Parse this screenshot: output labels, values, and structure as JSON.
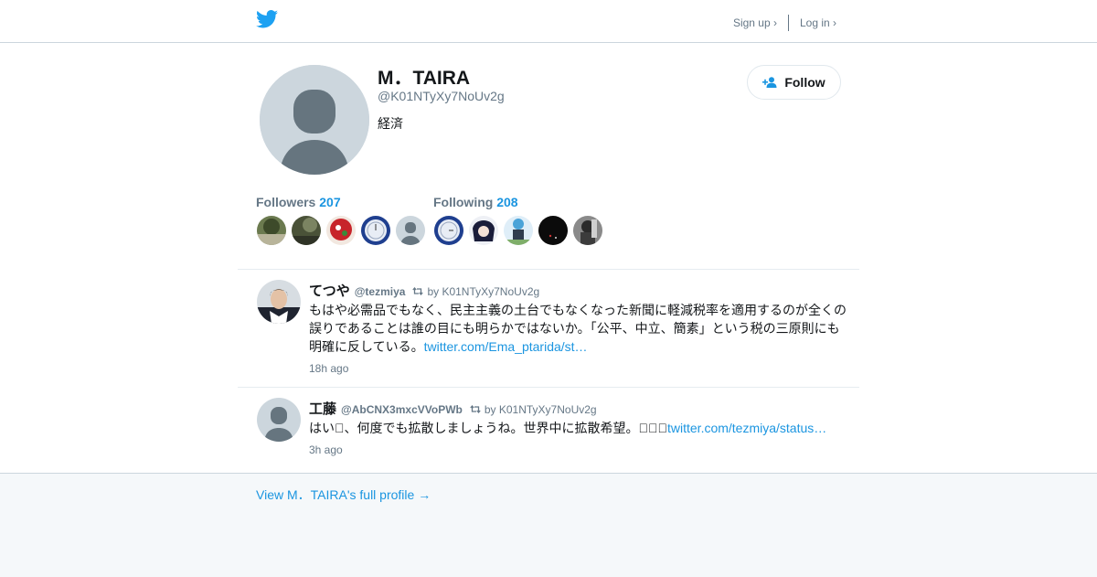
{
  "header": {
    "signup_label": "Sign up ›",
    "login_label": "Log in ›",
    "logo_icon": "twitter-bird-icon"
  },
  "profile": {
    "name": "M．TAIRA",
    "handle": "@K01NTyXy7NoUv2g",
    "bio": "経済",
    "follow_label": "Follow"
  },
  "stats": {
    "followers_label": "Followers",
    "followers_count": "207",
    "following_label": "Following",
    "following_count": "208"
  },
  "tweets": [
    {
      "name": "てつや",
      "handle": "@tezmiya",
      "retweeted_by": "by K01NTyXy7NoUv2g",
      "text_line1": "もはや必需品でもなく、民主主義の土台でもなくなった新聞に軽減税率を適用するのが全くの",
      "text_line2": "誤りであることは誰の目にも明らかではないか。「公平、中立、簡素」という税の三原則にも",
      "text_line3": "明確に反している。",
      "link": "twitter.com/Ema_ptarida/st…",
      "time": "18h ago"
    },
    {
      "name": "工藤",
      "handle": "@AbCNX3mxcVVoPWb",
      "retweeted_by": "by K01NTyXy7NoUv2g",
      "text": "はい􀀀、何度でも拡散しましょうね。世界中に拡散希望。􀀀􀀀􀀀",
      "link": "twitter.com/tezmiya/status…",
      "time": "3h ago"
    }
  ],
  "footer": {
    "link_label": "View M．TAIRA's full profile →"
  },
  "colors": {
    "accent": "#1b95e0",
    "muted": "#657786",
    "border": "#e6ecf0",
    "footer_bg": "#f5f8fa"
  }
}
